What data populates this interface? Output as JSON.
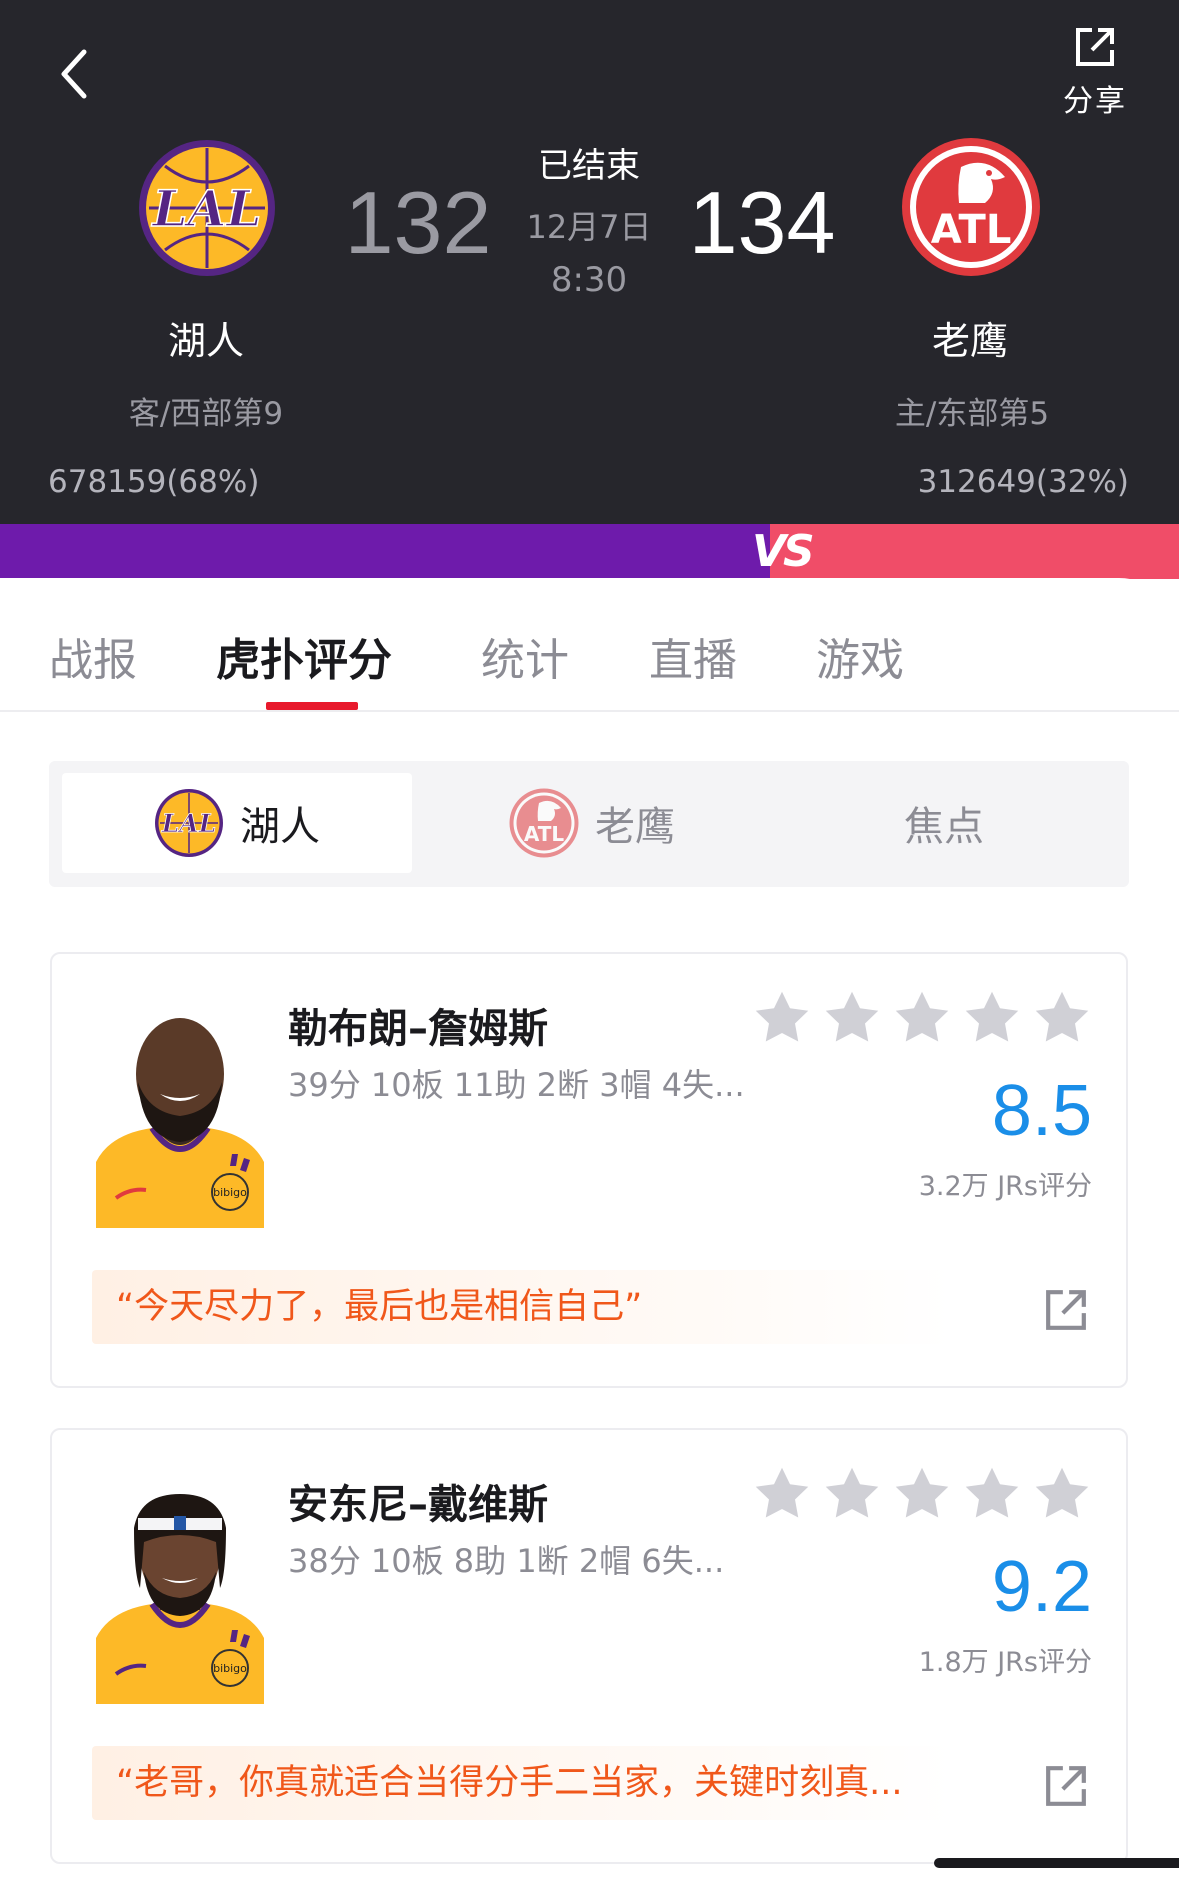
{
  "header": {
    "share_label": "分享",
    "status": "已结束",
    "date": "12月7日",
    "time": "8:30",
    "away": {
      "name": "湖人",
      "score": "132",
      "rank": "客/西部第9",
      "support": "678159(68%)",
      "logo_text": "LAL",
      "colors": {
        "primary": "#552583",
        "secondary": "#FDB927"
      }
    },
    "home": {
      "name": "老鹰",
      "score": "134",
      "rank": "主/东部第5",
      "support": "312649(32%)",
      "logo_text": "ATL",
      "colors": {
        "primary": "#E03A3E",
        "secondary": "#ffffff"
      }
    },
    "vs_label": "VS",
    "vs_colors": {
      "left": "#6e1bab",
      "right": "#f04d68"
    }
  },
  "tabs": [
    {
      "label": "战报",
      "active": false
    },
    {
      "label": "虎扑评分",
      "active": true
    },
    {
      "label": "统计",
      "active": false
    },
    {
      "label": "直播",
      "active": false
    },
    {
      "label": "游戏",
      "active": false
    }
  ],
  "team_filter": [
    {
      "label": "湖人",
      "active": true,
      "icon": "lakers-logo-icon"
    },
    {
      "label": "老鹰",
      "active": false,
      "icon": "hawks-logo-icon"
    },
    {
      "label": "焦点",
      "active": false
    }
  ],
  "players": [
    {
      "name": "勒布朗–詹姆斯",
      "stats": "39分 10板 11助 2断 3帽 4失...",
      "rating": "8.5",
      "rating_count": "3.2万 JRs评分",
      "quote": "“今天尽力了，最后也是相信自己”",
      "stars_filled": 0,
      "jersey_sponsor": "bibigo"
    },
    {
      "name": "安东尼–戴维斯",
      "stats": "38分 10板 8助 1断 2帽 6失...",
      "rating": "9.2",
      "rating_count": "1.8万 JRs评分",
      "quote": "“老哥，你真就适合当得分手二当家，关键时刻真...",
      "stars_filled": 0,
      "jersey_sponsor": "bibigo"
    }
  ],
  "colors": {
    "accent": "#e8192c",
    "rating": "#1a8ee8",
    "quote": "#f0571a",
    "star_empty": "#d0d0d6"
  }
}
